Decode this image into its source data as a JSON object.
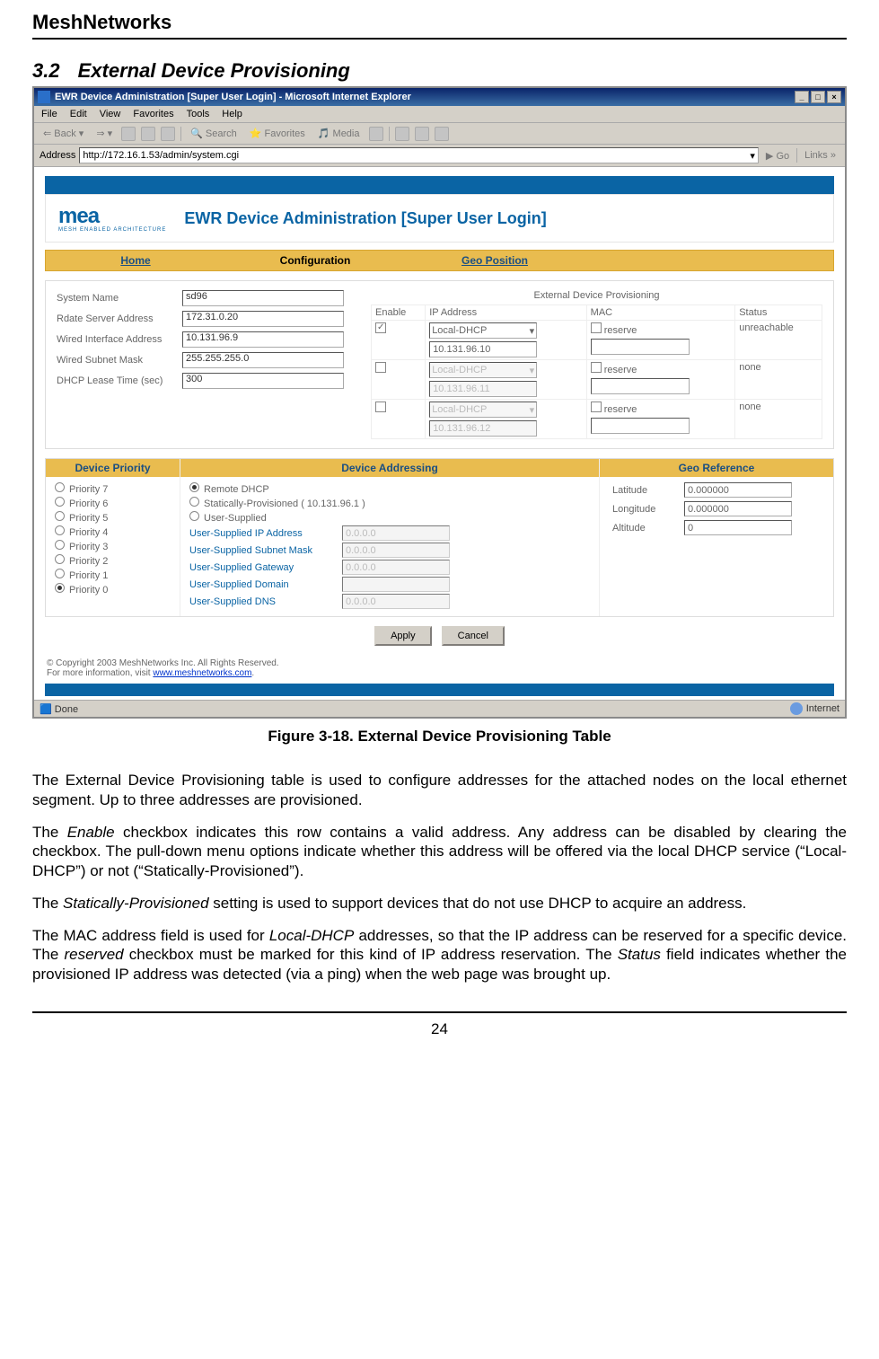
{
  "doc": {
    "header": "MeshNetworks",
    "section_num": "3.2",
    "section_title": "External Device Provisioning",
    "figure_caption": "Figure 3-18.   External Device Provisioning Table",
    "para1": "The External Device Provisioning table is used to configure addresses for the attached nodes on the local ethernet segment.  Up to three addresses are provisioned.",
    "para2_a": "The ",
    "para2_em1": "Enable",
    "para2_b": " checkbox indicates this row contains a valid address.  Any address can be disabled by clearing the checkbox.  The pull-down menu options indicate whether this address will be offered via the local DHCP service (“Local-DHCP”) or not (“Statically-Provisioned”).",
    "para3_a": "The ",
    "para3_em1": "Statically-Provisioned",
    "para3_b": " setting is used to support devices that do not use DHCP to acquire an address.",
    "para4_a": "The MAC address field is used for ",
    "para4_em1": "Local-DHCP",
    "para4_b": " addresses, so that the IP address can be reserved for a specific device.  The ",
    "para4_em2": "reserved",
    "para4_c": " checkbox must be marked for this kind of IP address reservation.  The ",
    "para4_em3": "Status",
    "para4_d": " field indicates whether the provisioned IP address was detected (via a ping) when the web page was brought up.",
    "pagenum": "24"
  },
  "ie": {
    "title": "EWR Device Administration [Super User Login] - Microsoft Internet Explorer",
    "menus": [
      "File",
      "Edit",
      "View",
      "Favorites",
      "Tools",
      "Help"
    ],
    "toolbar": {
      "back": "Back",
      "search": "Search",
      "favorites": "Favorites",
      "media": "Media"
    },
    "address_label": "Address",
    "address_value": "http://172.16.1.53/admin/system.cgi",
    "go": "Go",
    "links": "Links",
    "status_done": "Done",
    "status_zone": "Internet"
  },
  "app": {
    "logo": "mea",
    "logo_sub": "MESH ENABLED ARCHITECTURE",
    "page_title": "EWR Device Administration [Super User Login]",
    "tabs": {
      "home": "Home",
      "config": "Configuration",
      "geo": "Geo Position"
    },
    "sys": {
      "name_label": "System Name",
      "name_val": "sd96",
      "rds_label": "Rdate Server Address",
      "rds_val": "172.31.0.20",
      "wia_label": "Wired Interface Address",
      "wia_val": "10.131.96.9",
      "wsm_label": "Wired Subnet Mask",
      "wsm_val": "255.255.255.0",
      "dhcp_label": "DHCP Lease Time (sec)",
      "dhcp_val": "300"
    },
    "edp": {
      "heading": "External Device Provisioning",
      "cols": {
        "enable": "Enable",
        "ip": "IP Address",
        "mac": "MAC",
        "status": "Status"
      },
      "rows": [
        {
          "mode": "Local-DHCP",
          "ip": "10.131.96.10",
          "reserve": "reserve",
          "status": "unreachable",
          "enabled": true,
          "dim": false
        },
        {
          "mode": "Local-DHCP",
          "ip": "10.131.96.11",
          "reserve": "reserve",
          "status": "none",
          "enabled": false,
          "dim": true
        },
        {
          "mode": "Local-DHCP",
          "ip": "10.131.96.12",
          "reserve": "reserve",
          "status": "none",
          "enabled": false,
          "dim": true
        }
      ]
    },
    "priority": {
      "heading": "Device Priority",
      "items": [
        "Priority 7",
        "Priority 6",
        "Priority 5",
        "Priority 4",
        "Priority 3",
        "Priority 2",
        "Priority 1",
        "Priority 0"
      ]
    },
    "addressing": {
      "heading": "Device Addressing",
      "remote": "Remote DHCP",
      "static": "Statically-Provisioned ( 10.131.96.1 )",
      "user": "User-Supplied",
      "us_ip": "User-Supplied IP Address",
      "us_ip_v": "0.0.0.0",
      "us_mask": "User-Supplied Subnet Mask",
      "us_mask_v": "0.0.0.0",
      "us_gw": "User-Supplied Gateway",
      "us_gw_v": "0.0.0.0",
      "us_dom": "User-Supplied Domain",
      "us_dom_v": "",
      "us_dns": "User-Supplied DNS",
      "us_dns_v": "0.0.0.0"
    },
    "georef": {
      "heading": "Geo Reference",
      "lat_l": "Latitude",
      "lat_v": "0.000000",
      "lon_l": "Longitude",
      "lon_v": "0.000000",
      "alt_l": "Altitude",
      "alt_v": "0"
    },
    "apply": "Apply",
    "cancel": "Cancel",
    "copyright": "© Copyright 2003 MeshNetworks Inc.   All Rights Reserved.",
    "moreinfo_a": "For more information, visit ",
    "moreinfo_link": "www.meshnetworks.com"
  }
}
